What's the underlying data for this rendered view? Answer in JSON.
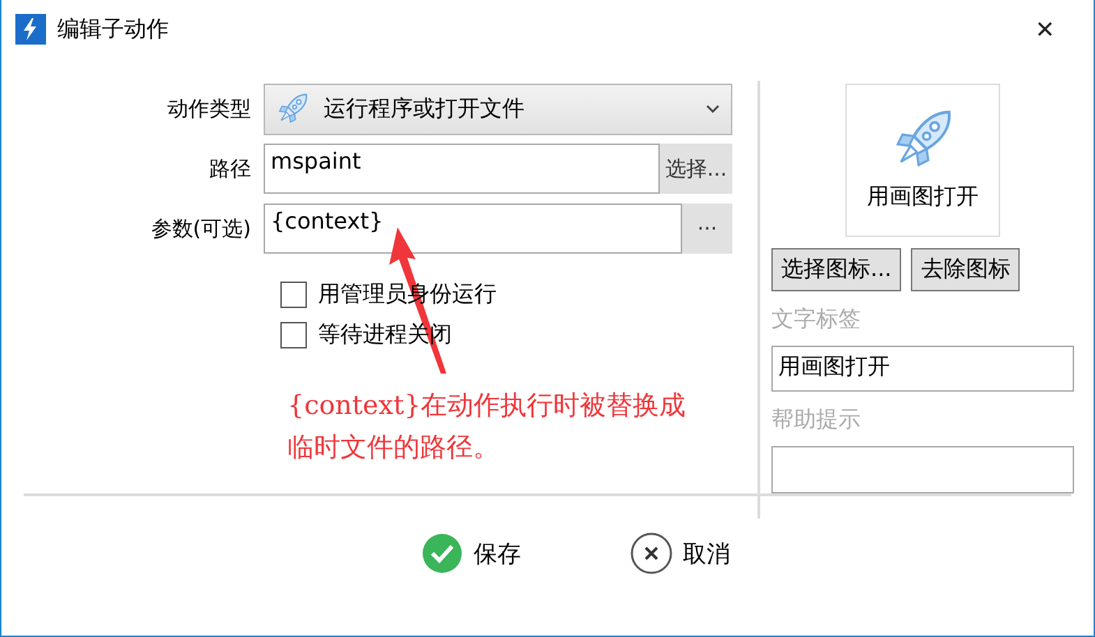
{
  "window": {
    "title": "编辑子动作",
    "close": "✕"
  },
  "action_type": {
    "label": "动作类型",
    "value": "运行程序或打开文件"
  },
  "path": {
    "label": "路径",
    "value": "mspaint",
    "button": "选择..."
  },
  "args": {
    "label": "参数(可选)",
    "value": "{context}",
    "button": "···"
  },
  "checkboxes": [
    {
      "label": "用管理员身份运行",
      "checked": false
    },
    {
      "label": "等待进程关闭",
      "checked": false
    }
  ],
  "annotation": {
    "lines": [
      "{context}在动作执行时被替换成",
      "临时文件的路径。"
    ]
  },
  "icon_preview": {
    "caption": "用画图打开"
  },
  "icon_buttons": [
    "选择图标...",
    "去除图标"
  ],
  "text_label": {
    "label": "文字标签",
    "value": "用画图打开"
  },
  "help": {
    "label": "帮助提示"
  },
  "footer": [
    {
      "kind": "save",
      "label": "保存"
    },
    {
      "kind": "cancel",
      "label": "取消"
    }
  ]
}
